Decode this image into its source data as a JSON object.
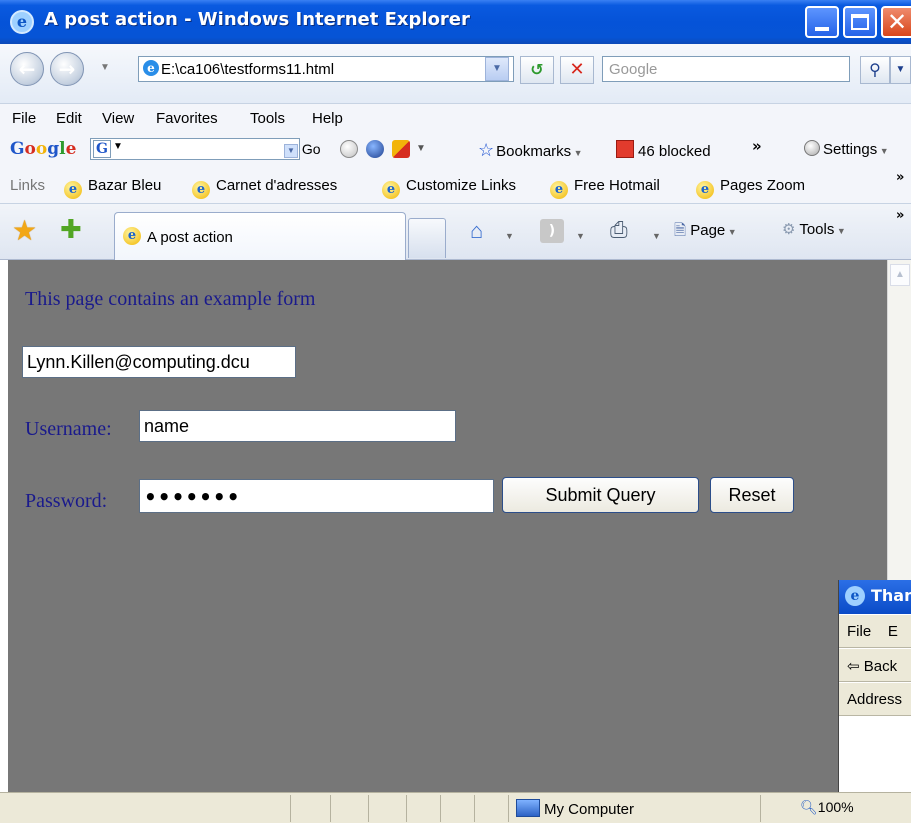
{
  "window": {
    "title": "A post action - Windows Internet Explorer"
  },
  "nav": {
    "address": "E:\\ca106\\testforms11.html",
    "search_placeholder": "Google"
  },
  "menu": [
    "File",
    "Edit",
    "View",
    "Favorites",
    "Tools",
    "Help"
  ],
  "google_toolbar": {
    "logo": "Google",
    "input_icon": "G",
    "go": "Go",
    "bookmarks": "Bookmarks",
    "blocked": "46 blocked",
    "more": "»",
    "settings": "Settings"
  },
  "links": {
    "label": "Links",
    "items": [
      "Bazar Bleu",
      "Carnet d'adresses",
      "Customize Links",
      "Free Hotmail",
      "Pages Zoom"
    ],
    "more": "»"
  },
  "tab": {
    "label": "A post action"
  },
  "command_bar": {
    "page": "Page",
    "tools": "Tools",
    "more": "»"
  },
  "page": {
    "intro": "This page contains an example form",
    "email_value": "Lynn.Killen@computing.dcu",
    "username_label": "Username:",
    "username_value": "name",
    "password_label": "Password:",
    "password_value": "•••••••",
    "submit_label": "Submit Query",
    "reset_label": "Reset"
  },
  "popup": {
    "title": "Than",
    "menu_first": "File",
    "menu_second": "E",
    "back": "⇦ Back",
    "address": "Address"
  },
  "status": {
    "zone": "My Computer",
    "zoom": "100%"
  },
  "colors": {
    "content_bg": "#777777",
    "form_text": "#1a1a8c",
    "titlebar": "#0553d8"
  }
}
